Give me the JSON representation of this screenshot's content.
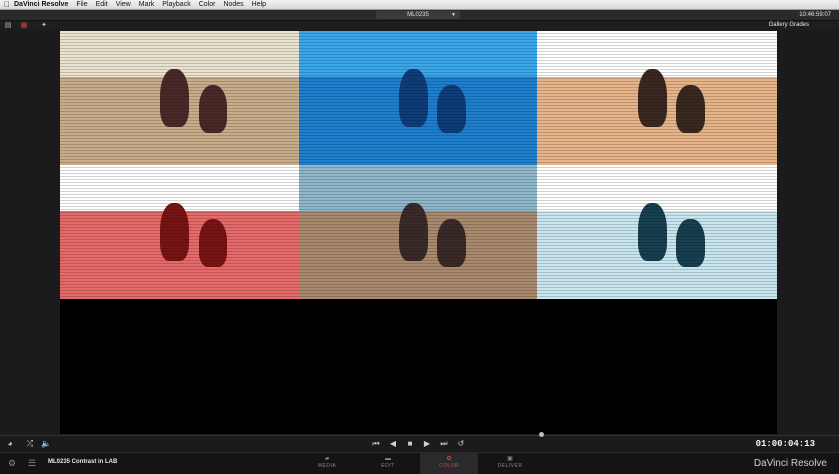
{
  "menubar": {
    "app_name": "DaVinci Resolve",
    "items": [
      "File",
      "Edit",
      "View",
      "Mark",
      "Playback",
      "Color",
      "Nodes",
      "Help"
    ]
  },
  "titlebar": {
    "clip_selector": "ML0235",
    "clock": "10:46:59:07"
  },
  "toolbar": {
    "gallery_title": "Gallery Grades"
  },
  "stills": [
    {
      "tint_sky": "#e9e3cf",
      "tint_ground": "#c7ad8a",
      "fig": "#4a2a28"
    },
    {
      "tint_sky": "#3aa7ea",
      "tint_ground": "#1e7fcf",
      "fig": "#0f3d7a"
    },
    {
      "tint_sky": "#ffffff",
      "tint_ground": "#e7b48a",
      "fig": "#3a2820"
    },
    {
      "tint_sky": "#ffffff",
      "tint_ground": "#e76a6a",
      "fig": "#7a1414"
    },
    {
      "tint_sky": "#8fb7c9",
      "tint_ground": "#a98a6e",
      "fig": "#3a2a28"
    },
    {
      "tint_sky": "#ffffff",
      "tint_ground": "#c9e6f0",
      "fig": "#16404f"
    }
  ],
  "transport": {
    "timecode": "01:00:04:13"
  },
  "bottombar": {
    "clip_name": "ML0235 Contrast in LAB",
    "pages": [
      {
        "label": "MEDIA",
        "icon": "media-icon"
      },
      {
        "label": "EDIT",
        "icon": "edit-icon"
      },
      {
        "label": "COLOR",
        "icon": "color-icon",
        "active": true
      },
      {
        "label": "DELIVER",
        "icon": "deliver-icon"
      }
    ],
    "brand": "DaVinci Resolve"
  },
  "colors": {
    "accent_active": "#d9463a",
    "selected_outline": "#e0a23a",
    "current_outline": "#2ec3c9"
  }
}
